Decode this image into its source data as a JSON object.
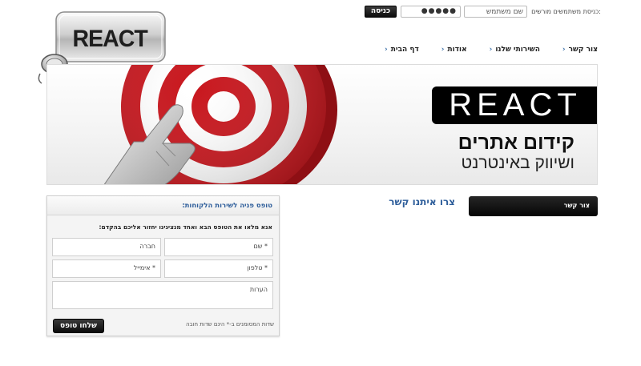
{
  "login": {
    "label": "כניסת משתמשים מורשים:",
    "username_value": "שם משתמש",
    "password_value": "●●●●●",
    "submit_label": "כניסה"
  },
  "logo": {
    "text": "REACT",
    "key_text": "key"
  },
  "nav": {
    "items": [
      {
        "label": "דף הבית"
      },
      {
        "label": "אודות"
      },
      {
        "label": "השירותי שלנו"
      },
      {
        "label": "צור קשר"
      }
    ]
  },
  "banner": {
    "logo_text": "REACT",
    "line1": "קידום אתרים",
    "line2": "ושיווק באינטרנט"
  },
  "sidebar": {
    "tab_label": "צור קשר"
  },
  "contact": {
    "title": "צרו איתנו קשר"
  },
  "form": {
    "header": "טופס פניה לשירות הלקוחות:",
    "intro": "אנא מלאו את הטופס הבא ואחד מנציגינו יחזור אליכם בהקדם:",
    "name_value": "* שם",
    "company_value": "חברה",
    "phone_value": "* טלפון",
    "email_value": "* אימייל",
    "notes_value": "הערות",
    "required_note": "שדות המסומנים ב-* הינם שדות חובה",
    "submit_label": "שלחו טופס"
  },
  "colors": {
    "accent_blue": "#2d5d9a",
    "target_red": "#c8161d",
    "dark_button": "#111111"
  }
}
